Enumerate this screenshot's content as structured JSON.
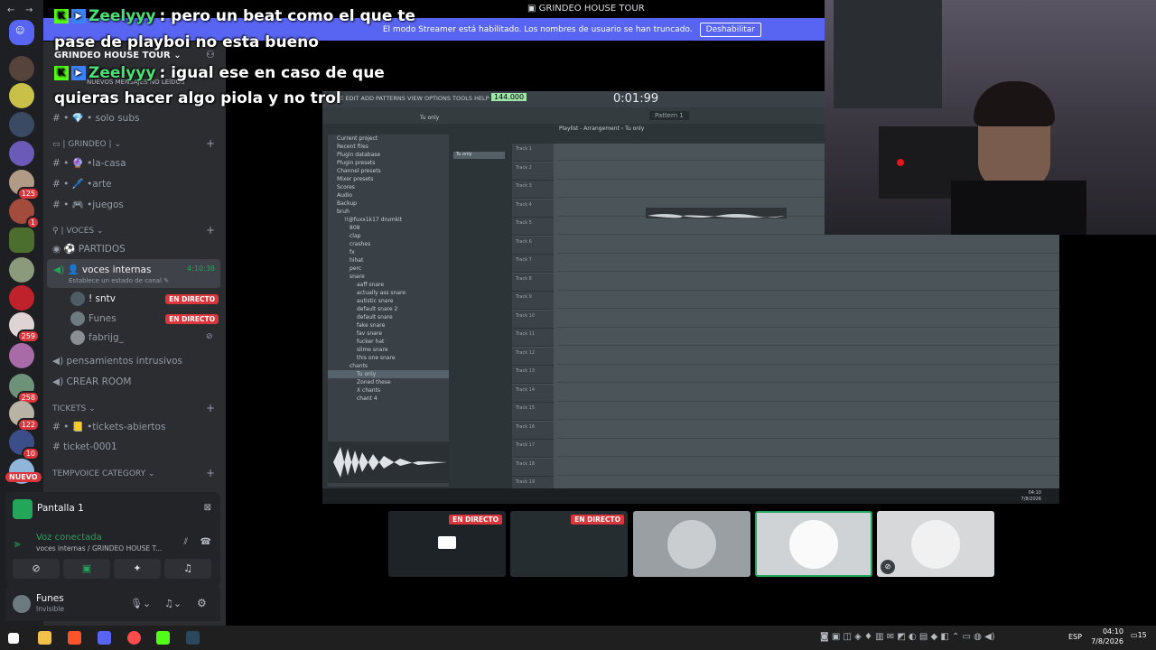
{
  "banner": {
    "title": "GRINDEO HOUSE TOUR",
    "message": "El modo Streamer está habilitado. Los nombres de usuario se han truncado.",
    "button": "Deshabilitar"
  },
  "server": {
    "name": "GRINDEO HOUSE TOUR",
    "unread": "NUEVOS MENSAJES NO LEÍDOS"
  },
  "chat": [
    {
      "user": "Zeelyyy",
      "text": ": pero un beat como el que te"
    },
    {
      "user": "",
      "text": "pase de playboi no esta bueno"
    },
    {
      "user": "Zeelyyy",
      "text": ": igual ese en caso de que"
    },
    {
      "user": "",
      "text": "quieras hacer algo piola y no trol"
    }
  ],
  "channels": {
    "solo_subs": "• 💎 • solo subs",
    "cat_grindeo": "| GRINDEO |",
    "la_casa": "• 🔮 •la-casa",
    "arte": "• 🖊️ •arte",
    "juegos": "• 🎮 •juegos",
    "cat_voces": "| VOCES",
    "partidos": "⚽ PARTIDOS",
    "voces_internas": "voces internas",
    "voice_timer": "4:10:38",
    "voice_status": "Establece un estado de canal",
    "members": [
      {
        "name": "! sntv",
        "live": "EN DIRECTO"
      },
      {
        "name": "Funes",
        "live": "EN DIRECTO"
      },
      {
        "name": "fabrijg_",
        "live": ""
      }
    ],
    "pensamientos": "pensamientos intrusivos",
    "crear_room": "CREAR ROOM",
    "cat_tickets": "TICKETS",
    "tickets_abiertos": "• 📒 •tickets-abiertos",
    "ticket": "ticket-0001",
    "cat_tempvoice": "TEMPVOICE CATEGORY"
  },
  "rail": {
    "badges": [
      "125",
      "1",
      "259",
      "258",
      "122",
      "10"
    ],
    "nuevo": "NUEVO"
  },
  "voice_panel": {
    "screen": "Pantalla 1",
    "status": "Voz conectada",
    "location": "voces internas / GRINDEO HOUSE T..."
  },
  "user": {
    "name": "Funes",
    "status": "Invisible"
  },
  "fl": {
    "menu": "FILE EDIT ADD PATTERNS VIEW OPTIONS TOOLS HELP",
    "time": "0:01:99",
    "bpm": "144.000",
    "pattern": "Pattern 1",
    "playlist_title": "Playlist - Arrangement › Tu only",
    "hint": "Tu only",
    "clip_label": "Tu only",
    "browser": [
      "Current project",
      "Recent files",
      "Plugin database",
      "Plugin presets",
      "Channel presets",
      "Mixer presets",
      "Scores",
      "Audio",
      "Backup",
      "bruh",
      "!!@fuxx1k17 drumkit",
      "808",
      "clap",
      "crashes",
      "fx",
      "hihat",
      "perc",
      "snare",
      "aaff snare",
      "actually ass snare",
      "autistic snare",
      "default snare 2",
      "default snare",
      "fake snare",
      "fav snare",
      "fucker hat",
      "slime snare",
      "this one snare",
      "chants",
      "Tu only",
      "Zoned these",
      "X chants",
      "chant 4"
    ],
    "tracks": [
      "Track 1",
      "Track 2",
      "Track 3",
      "Track 4",
      "Track 5",
      "Track 6",
      "Track 7",
      "Track 8",
      "Track 9",
      "Track 10",
      "Track 11",
      "Track 12",
      "Track 13",
      "Track 14",
      "Track 15",
      "Track 16",
      "Track 17",
      "Track 18",
      "Track 19"
    ],
    "clock": "04:10",
    "date": "7/8/2026"
  },
  "thumbs": [
    {
      "live": "EN DIRECTO"
    },
    {
      "live": "EN DIRECTO"
    },
    {
      "live": ""
    },
    {
      "live": ""
    },
    {
      "live": ""
    }
  ],
  "taskbar": {
    "lang": "ESP",
    "time": "04:10",
    "date": "7/8/2026",
    "notif": "15"
  }
}
